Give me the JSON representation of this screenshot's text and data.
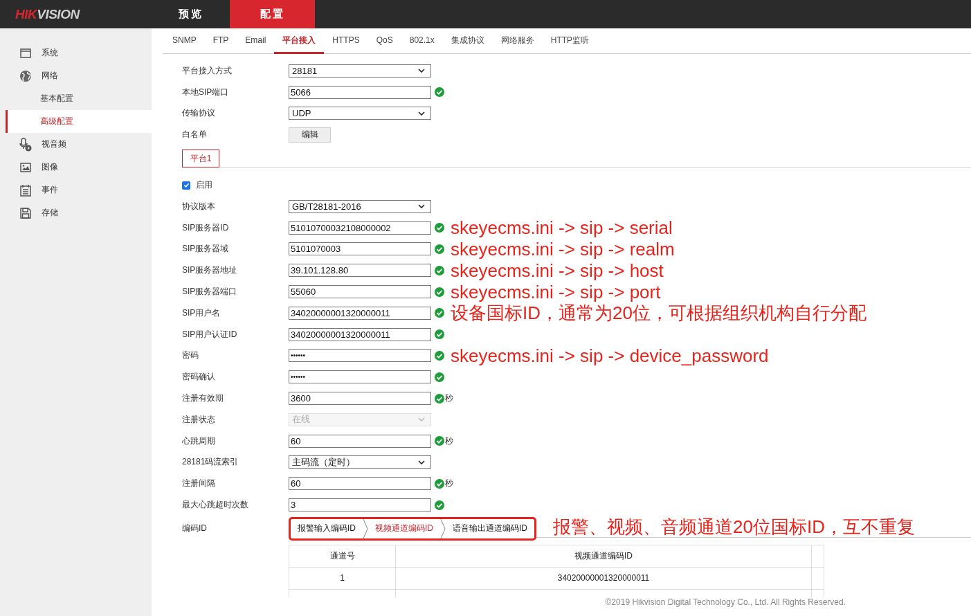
{
  "header": {
    "logo": [
      "HIK",
      "VISION"
    ],
    "nav": [
      {
        "label": "预览",
        "selected": false
      },
      {
        "label": "配置",
        "selected": true
      }
    ]
  },
  "sidebar": {
    "items": [
      {
        "label": "系统",
        "selected": false
      },
      {
        "label": "网络",
        "selected": false,
        "children": [
          {
            "label": "基本配置",
            "selected": false
          },
          {
            "label": "高级配置",
            "selected": true
          }
        ]
      },
      {
        "label": "视音频",
        "selected": false
      },
      {
        "label": "图像",
        "selected": false
      },
      {
        "label": "事件",
        "selected": false
      },
      {
        "label": "存储",
        "selected": false
      }
    ]
  },
  "tabs": [
    {
      "label": "SNMP",
      "selected": false
    },
    {
      "label": "FTP",
      "selected": false
    },
    {
      "label": "Email",
      "selected": false
    },
    {
      "label": "平台接入",
      "selected": true
    },
    {
      "label": "HTTPS",
      "selected": false
    },
    {
      "label": "QoS",
      "selected": false
    },
    {
      "label": "802.1x",
      "selected": false
    },
    {
      "label": "集成协议",
      "selected": false
    },
    {
      "label": "网络服务",
      "selected": false
    },
    {
      "label": "HTTP监听",
      "selected": false
    }
  ],
  "general_fields": [
    {
      "kind": "select",
      "label": "平台接入方式",
      "value": "28181",
      "disabled": false
    },
    {
      "kind": "input",
      "label": "本地SIP端口",
      "value": "5066",
      "valid": true
    },
    {
      "kind": "select",
      "label": "传输协议",
      "value": "UDP",
      "disabled": false
    },
    {
      "kind": "button",
      "label": "白名单",
      "button": "编辑"
    }
  ],
  "platform_tabs": [
    {
      "label": "平台1",
      "selected": true
    }
  ],
  "enable": {
    "label": "启用",
    "checked": true
  },
  "platform_fields": [
    {
      "kind": "select",
      "label": "协议版本",
      "value": "GB/T28181-2016",
      "disabled": false
    },
    {
      "kind": "input",
      "label": "SIP服务器ID",
      "value": "51010700032108000002",
      "valid": true,
      "note": "skeyecms.ini -> sip -> serial"
    },
    {
      "kind": "input",
      "label": "SIP服务器域",
      "value": "5101070003",
      "valid": true,
      "note": "skeyecms.ini -> sip -> realm"
    },
    {
      "kind": "input",
      "label": "SIP服务器地址",
      "value": "39.101.128.80",
      "valid": true,
      "note": "skeyecms.ini -> sip -> host"
    },
    {
      "kind": "input",
      "label": "SIP服务器端口",
      "value": "55060",
      "valid": true,
      "note": "skeyecms.ini -> sip -> port"
    },
    {
      "kind": "input",
      "label": "SIP用户名",
      "value": "34020000001320000011",
      "valid": true,
      "note": "设备国标ID，通常为20位，可根据组织机构自行分配"
    },
    {
      "kind": "input",
      "label": "SIP用户认证ID",
      "value": "34020000001320000011",
      "valid": true
    },
    {
      "kind": "password",
      "label": "密码",
      "value": "••••••",
      "valid": true,
      "note": "skeyecms.ini -> sip -> device_password"
    },
    {
      "kind": "password",
      "label": "密码确认",
      "value": "••••••",
      "valid": true
    },
    {
      "kind": "input",
      "label": "注册有效期",
      "value": "3600",
      "valid": true,
      "unit": "秒"
    },
    {
      "kind": "select",
      "label": "注册状态",
      "value": "在线",
      "disabled": true
    },
    {
      "kind": "input",
      "label": "心跳周期",
      "value": "60",
      "valid": true,
      "unit": "秒"
    },
    {
      "kind": "select",
      "label": "28181码流索引",
      "value": "主码流（定时）",
      "disabled": false
    },
    {
      "kind": "input",
      "label": "注册间隔",
      "value": "60",
      "valid": true,
      "unit": "秒"
    },
    {
      "kind": "input",
      "label": "最大心跳超时次数",
      "value": "3",
      "valid": true
    }
  ],
  "code_id": {
    "label": "编码ID",
    "tabs": [
      {
        "label": "报警输入编码ID",
        "selected": false
      },
      {
        "label": "视频通道编码ID",
        "selected": true
      },
      {
        "label": "语音输出通道编码ID",
        "selected": false
      }
    ],
    "note": "报警、视频、音频通道20位国标ID，互不重复"
  },
  "table": {
    "columns": [
      "通道号",
      "视频通道编码ID"
    ],
    "rows": [
      [
        "1",
        "34020000001320000011"
      ]
    ]
  },
  "footer": "©2019 Hikvision Digital Technology Co., Ltd. All Rights Reserved."
}
